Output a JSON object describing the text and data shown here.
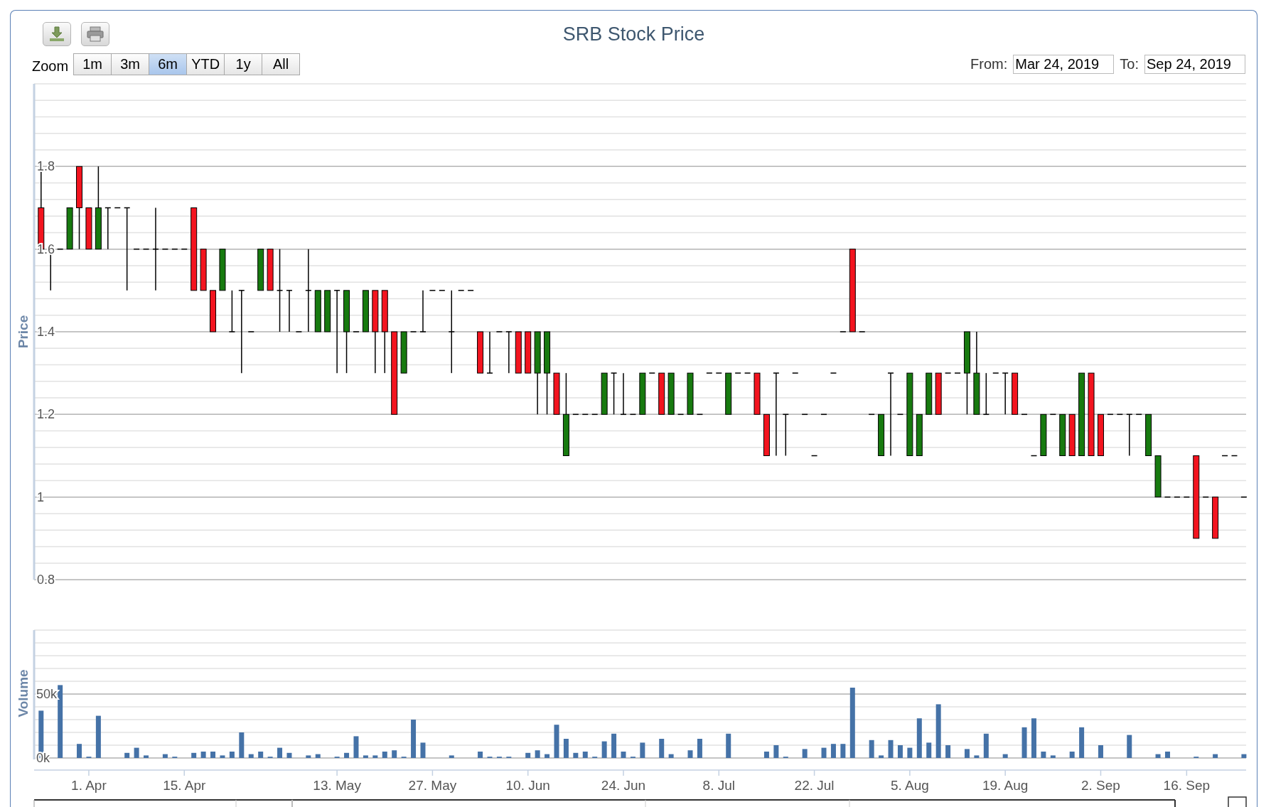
{
  "export_buttons": [
    {
      "kind": "download"
    },
    {
      "kind": "print"
    }
  ],
  "title": "SRB Stock Price",
  "range_selector": {
    "label": "Zoom",
    "buttons": [
      {
        "label": "1m",
        "selected": false
      },
      {
        "label": "3m",
        "selected": false
      },
      {
        "label": "6m",
        "selected": true
      },
      {
        "label": "YTD",
        "selected": false
      },
      {
        "label": "1y",
        "selected": false
      },
      {
        "label": "All",
        "selected": false
      }
    ]
  },
  "date_range": {
    "from_label": "From:",
    "from": "Mar 24, 2019",
    "to_label": "To:",
    "to": "Sep 24, 2019"
  },
  "price_panel": {
    "chart_data": {
      "type": "candlestick",
      "ylabel": "Price",
      "grid": true,
      "categories": [
        null,
        null,
        null,
        null,
        null,
        null,
        null,
        null,
        null,
        null,
        null,
        null,
        null,
        null,
        null,
        null,
        null,
        null,
        null,
        null,
        null,
        null,
        null,
        null,
        null,
        null,
        null,
        null,
        null,
        null,
        null,
        null,
        null,
        null,
        null,
        null,
        null,
        null,
        null,
        null,
        null,
        null,
        null,
        null,
        null,
        null,
        null,
        null,
        null,
        null,
        null,
        null,
        null,
        null,
        null,
        null,
        null,
        null,
        null,
        null,
        null,
        null,
        null,
        null,
        null,
        null,
        null,
        null,
        null,
        null,
        null,
        null,
        null,
        null,
        null,
        null,
        null,
        null,
        null,
        null,
        null,
        null,
        null,
        null,
        null,
        null,
        null,
        null,
        null,
        null,
        null,
        null,
        null,
        null,
        null,
        null,
        null,
        null,
        null,
        null,
        null,
        null,
        null,
        null,
        null,
        null,
        null,
        null,
        null,
        null,
        null,
        null,
        null,
        null,
        null,
        null,
        null,
        null,
        null,
        null,
        null,
        null,
        null,
        null,
        null,
        null,
        null
      ],
      "ylim": [
        0.8,
        2.0
      ],
      "yticks": [
        0.8,
        1,
        1.2,
        1.4,
        1.6,
        1.8
      ],
      "ohlc": [
        [
          1.7,
          1.8,
          1.6,
          1.6
        ],
        [
          1.6,
          1.6,
          1.5,
          1.6
        ],
        [
          1.6,
          1.6,
          1.6,
          1.6
        ],
        [
          1.6,
          1.7,
          1.6,
          1.7
        ],
        [
          1.8,
          1.8,
          1.6,
          1.7
        ],
        [
          1.7,
          1.7,
          1.6,
          1.6
        ],
        [
          1.6,
          1.8,
          1.6,
          1.7
        ],
        [
          1.7,
          1.7,
          1.6,
          1.7
        ],
        [
          1.7,
          1.7,
          1.7,
          1.7
        ],
        [
          1.7,
          1.7,
          1.5,
          1.7
        ],
        [
          1.6,
          1.6,
          1.6,
          1.6
        ],
        [
          1.6,
          1.6,
          1.6,
          1.6
        ],
        [
          1.6,
          1.7,
          1.5,
          1.6
        ],
        [
          1.6,
          1.6,
          1.6,
          1.6
        ],
        [
          1.6,
          1.6,
          1.6,
          1.6
        ],
        [
          1.6,
          1.6,
          1.6,
          1.6
        ],
        [
          1.7,
          1.7,
          1.5,
          1.5
        ],
        [
          1.6,
          1.6,
          1.5,
          1.5
        ],
        [
          1.5,
          1.5,
          1.4,
          1.4
        ],
        [
          1.5,
          1.6,
          1.5,
          1.6
        ],
        [
          1.4,
          1.5,
          1.4,
          1.4
        ],
        [
          1.5,
          1.5,
          1.3,
          1.5
        ],
        [
          1.4,
          1.4,
          1.4,
          1.4
        ],
        [
          1.5,
          1.6,
          1.5,
          1.6
        ],
        [
          1.6,
          1.6,
          1.5,
          1.5
        ],
        [
          1.5,
          1.6,
          1.4,
          1.5
        ],
        [
          1.5,
          1.5,
          1.4,
          1.5
        ],
        [
          1.4,
          1.4,
          1.4,
          1.4
        ],
        [
          1.5,
          1.6,
          1.4,
          1.5
        ],
        [
          1.4,
          1.5,
          1.4,
          1.5
        ],
        [
          1.4,
          1.5,
          1.4,
          1.5
        ],
        [
          1.5,
          1.5,
          1.3,
          1.5
        ],
        [
          1.4,
          1.5,
          1.3,
          1.5
        ],
        [
          1.4,
          1.4,
          1.4,
          1.4
        ],
        [
          1.4,
          1.5,
          1.4,
          1.5
        ],
        [
          1.5,
          1.5,
          1.3,
          1.4
        ],
        [
          1.5,
          1.5,
          1.3,
          1.4
        ],
        [
          1.4,
          1.4,
          1.2,
          1.2
        ],
        [
          1.3,
          1.4,
          1.3,
          1.4
        ],
        [
          1.4,
          1.4,
          1.4,
          1.4
        ],
        [
          1.4,
          1.5,
          1.4,
          1.4
        ],
        [
          1.5,
          1.5,
          1.5,
          1.5
        ],
        [
          1.5,
          1.5,
          1.5,
          1.5
        ],
        [
          1.4,
          1.5,
          1.3,
          1.4
        ],
        [
          1.5,
          1.5,
          1.5,
          1.5
        ],
        [
          1.5,
          1.5,
          1.5,
          1.5
        ],
        [
          1.4,
          1.4,
          1.3,
          1.3
        ],
        [
          1.3,
          1.4,
          1.3,
          1.3
        ],
        [
          1.4,
          1.4,
          1.4,
          1.4
        ],
        [
          1.4,
          1.4,
          1.3,
          1.4
        ],
        [
          1.4,
          1.4,
          1.3,
          1.3
        ],
        [
          1.4,
          1.4,
          1.3,
          1.3
        ],
        [
          1.3,
          1.4,
          1.2,
          1.4
        ],
        [
          1.3,
          1.4,
          1.2,
          1.4
        ],
        [
          1.3,
          1.3,
          1.2,
          1.2
        ],
        [
          1.1,
          1.3,
          1.1,
          1.2
        ],
        [
          1.2,
          1.2,
          1.2,
          1.2
        ],
        [
          1.2,
          1.2,
          1.2,
          1.2
        ],
        [
          1.2,
          1.2,
          1.2,
          1.2
        ],
        [
          1.2,
          1.3,
          1.2,
          1.3
        ],
        [
          1.3,
          1.3,
          1.2,
          1.3
        ],
        [
          1.2,
          1.3,
          1.2,
          1.2
        ],
        [
          1.2,
          1.2,
          1.2,
          1.2
        ],
        [
          1.2,
          1.3,
          1.2,
          1.3
        ],
        [
          1.3,
          1.3,
          1.3,
          1.3
        ],
        [
          1.3,
          1.3,
          1.2,
          1.2
        ],
        [
          1.2,
          1.3,
          1.2,
          1.3
        ],
        [
          1.2,
          1.2,
          1.2,
          1.2
        ],
        [
          1.2,
          1.3,
          1.2,
          1.3
        ],
        [
          1.2,
          1.2,
          1.2,
          1.2
        ],
        [
          1.3,
          1.3,
          1.3,
          1.3
        ],
        [
          1.3,
          1.3,
          1.3,
          1.3
        ],
        [
          1.2,
          1.3,
          1.2,
          1.3
        ],
        [
          1.3,
          1.3,
          1.3,
          1.3
        ],
        [
          1.3,
          1.3,
          1.3,
          1.3
        ],
        [
          1.3,
          1.3,
          1.2,
          1.2
        ],
        [
          1.2,
          1.2,
          1.1,
          1.1
        ],
        [
          1.3,
          1.3,
          1.1,
          1.3
        ],
        [
          1.2,
          1.2,
          1.1,
          1.2
        ],
        [
          1.3,
          1.3,
          1.3,
          1.3
        ],
        [
          1.2,
          1.2,
          1.2,
          1.2
        ],
        [
          1.1,
          1.1,
          1.1,
          1.1
        ],
        [
          1.2,
          1.2,
          1.2,
          1.2
        ],
        [
          1.3,
          1.3,
          1.3,
          1.3
        ],
        [
          1.4,
          1.4,
          1.4,
          1.4
        ],
        [
          1.6,
          1.6,
          1.4,
          1.4
        ],
        [
          1.4,
          1.4,
          1.4,
          1.4
        ],
        [
          1.2,
          1.2,
          1.2,
          1.2
        ],
        [
          1.1,
          1.2,
          1.1,
          1.2
        ],
        [
          1.3,
          1.3,
          1.1,
          1.3
        ],
        [
          1.2,
          1.2,
          1.2,
          1.2
        ],
        [
          1.1,
          1.3,
          1.1,
          1.3
        ],
        [
          1.1,
          1.2,
          1.1,
          1.2
        ],
        [
          1.2,
          1.3,
          1.2,
          1.3
        ],
        [
          1.3,
          1.3,
          1.2,
          1.2
        ],
        [
          1.3,
          1.3,
          1.3,
          1.3
        ],
        [
          1.3,
          1.3,
          1.3,
          1.3
        ],
        [
          1.3,
          1.4,
          1.2,
          1.4
        ],
        [
          1.2,
          1.4,
          1.2,
          1.3
        ],
        [
          1.2,
          1.3,
          1.2,
          1.2
        ],
        [
          1.3,
          1.3,
          1.3,
          1.3
        ],
        [
          1.3,
          1.3,
          1.2,
          1.3
        ],
        [
          1.3,
          1.3,
          1.2,
          1.2
        ],
        [
          1.2,
          1.2,
          1.2,
          1.2
        ],
        [
          1.1,
          1.1,
          1.1,
          1.1
        ],
        [
          1.1,
          1.2,
          1.1,
          1.2
        ],
        [
          1.2,
          1.2,
          1.2,
          1.2
        ],
        [
          1.1,
          1.2,
          1.1,
          1.2
        ],
        [
          1.2,
          1.2,
          1.1,
          1.1
        ],
        [
          1.1,
          1.3,
          1.1,
          1.3
        ],
        [
          1.3,
          1.3,
          1.1,
          1.1
        ],
        [
          1.2,
          1.2,
          1.1,
          1.1
        ],
        [
          1.2,
          1.2,
          1.2,
          1.2
        ],
        [
          1.2,
          1.2,
          1.2,
          1.2
        ],
        [
          1.2,
          1.2,
          1.1,
          1.2
        ],
        [
          1.2,
          1.2,
          1.2,
          1.2
        ],
        [
          1.1,
          1.2,
          1.1,
          1.2
        ],
        [
          1.0,
          1.1,
          1.0,
          1.1
        ],
        [
          1.0,
          1.0,
          1.0,
          1.0
        ],
        [
          1.0,
          1.0,
          1.0,
          1.0
        ],
        [
          1.0,
          1.0,
          1.0,
          1.0
        ],
        [
          1.1,
          1.1,
          0.9,
          0.9
        ],
        [
          1.0,
          1.0,
          1.0,
          1.0
        ],
        [
          1.0,
          1.0,
          0.9,
          0.9
        ],
        [
          1.1,
          1.1,
          1.1,
          1.1
        ],
        [
          1.1,
          1.1,
          1.1,
          1.1
        ],
        [
          1.0,
          1.0,
          1.0,
          1.0
        ]
      ]
    }
  },
  "volume_panel": {
    "chart_data": {
      "type": "bar",
      "ylabel": "Volume",
      "grid": true,
      "ylim": [
        0,
        100000
      ],
      "yticks": [
        {
          "value": 0,
          "label": "0k"
        },
        {
          "value": 50000,
          "label": "50k"
        }
      ],
      "categories": [
        null,
        null,
        null,
        null,
        null,
        "1. Apr",
        null,
        null,
        null,
        null,
        null,
        null,
        null,
        null,
        null,
        "15. Apr",
        null,
        null,
        null,
        null,
        null,
        null,
        null,
        null,
        null,
        null,
        null,
        null,
        null,
        null,
        null,
        "13. May",
        null,
        null,
        null,
        null,
        null,
        null,
        null,
        null,
        null,
        "27. May",
        null,
        null,
        null,
        null,
        null,
        null,
        null,
        null,
        null,
        "10. Jun",
        null,
        null,
        null,
        null,
        null,
        null,
        null,
        null,
        null,
        "24. Jun",
        null,
        null,
        null,
        null,
        null,
        null,
        null,
        null,
        null,
        "8. Jul",
        null,
        null,
        null,
        null,
        null,
        null,
        null,
        null,
        null,
        "22. Jul",
        null,
        null,
        null,
        null,
        null,
        null,
        null,
        null,
        null,
        "5. Aug",
        null,
        null,
        null,
        null,
        null,
        null,
        null,
        null,
        null,
        "19. Aug",
        null,
        null,
        null,
        null,
        null,
        null,
        null,
        null,
        null,
        "2. Sep",
        null,
        null,
        null,
        null,
        null,
        null,
        null,
        null,
        "16. Sep",
        null,
        null,
        null,
        null,
        null,
        null
      ],
      "values": [
        37000,
        null,
        57000,
        null,
        11000,
        1000,
        33000,
        null,
        null,
        4000,
        8000,
        2000,
        null,
        3000,
        1000,
        null,
        4000,
        5000,
        5000,
        2000,
        5000,
        20000,
        3000,
        5000,
        1000,
        8000,
        4000,
        null,
        2000,
        3000,
        null,
        1000,
        4000,
        17000,
        2000,
        2000,
        5000,
        6000,
        1000,
        30000,
        12000,
        null,
        null,
        2000,
        null,
        null,
        5000,
        1000,
        1000,
        1000,
        null,
        4000,
        6000,
        3000,
        26000,
        15000,
        4000,
        5000,
        1000,
        13000,
        19000,
        5000,
        1000,
        12000,
        null,
        15000,
        3000,
        null,
        6000,
        15000,
        null,
        null,
        19000,
        null,
        null,
        null,
        5000,
        10000,
        1000,
        null,
        7000,
        null,
        8000,
        11000,
        11000,
        55000,
        null,
        14000,
        2000,
        14000,
        10000,
        8000,
        31000,
        12000,
        42000,
        10000,
        null,
        7000,
        2000,
        19000,
        null,
        3000,
        null,
        24000,
        31000,
        5000,
        2000,
        null,
        5000,
        24000,
        null,
        10000,
        null,
        null,
        18000,
        null,
        null,
        3000,
        5000,
        null,
        null,
        1000,
        null,
        3000,
        null,
        null,
        3000
      ]
    }
  }
}
